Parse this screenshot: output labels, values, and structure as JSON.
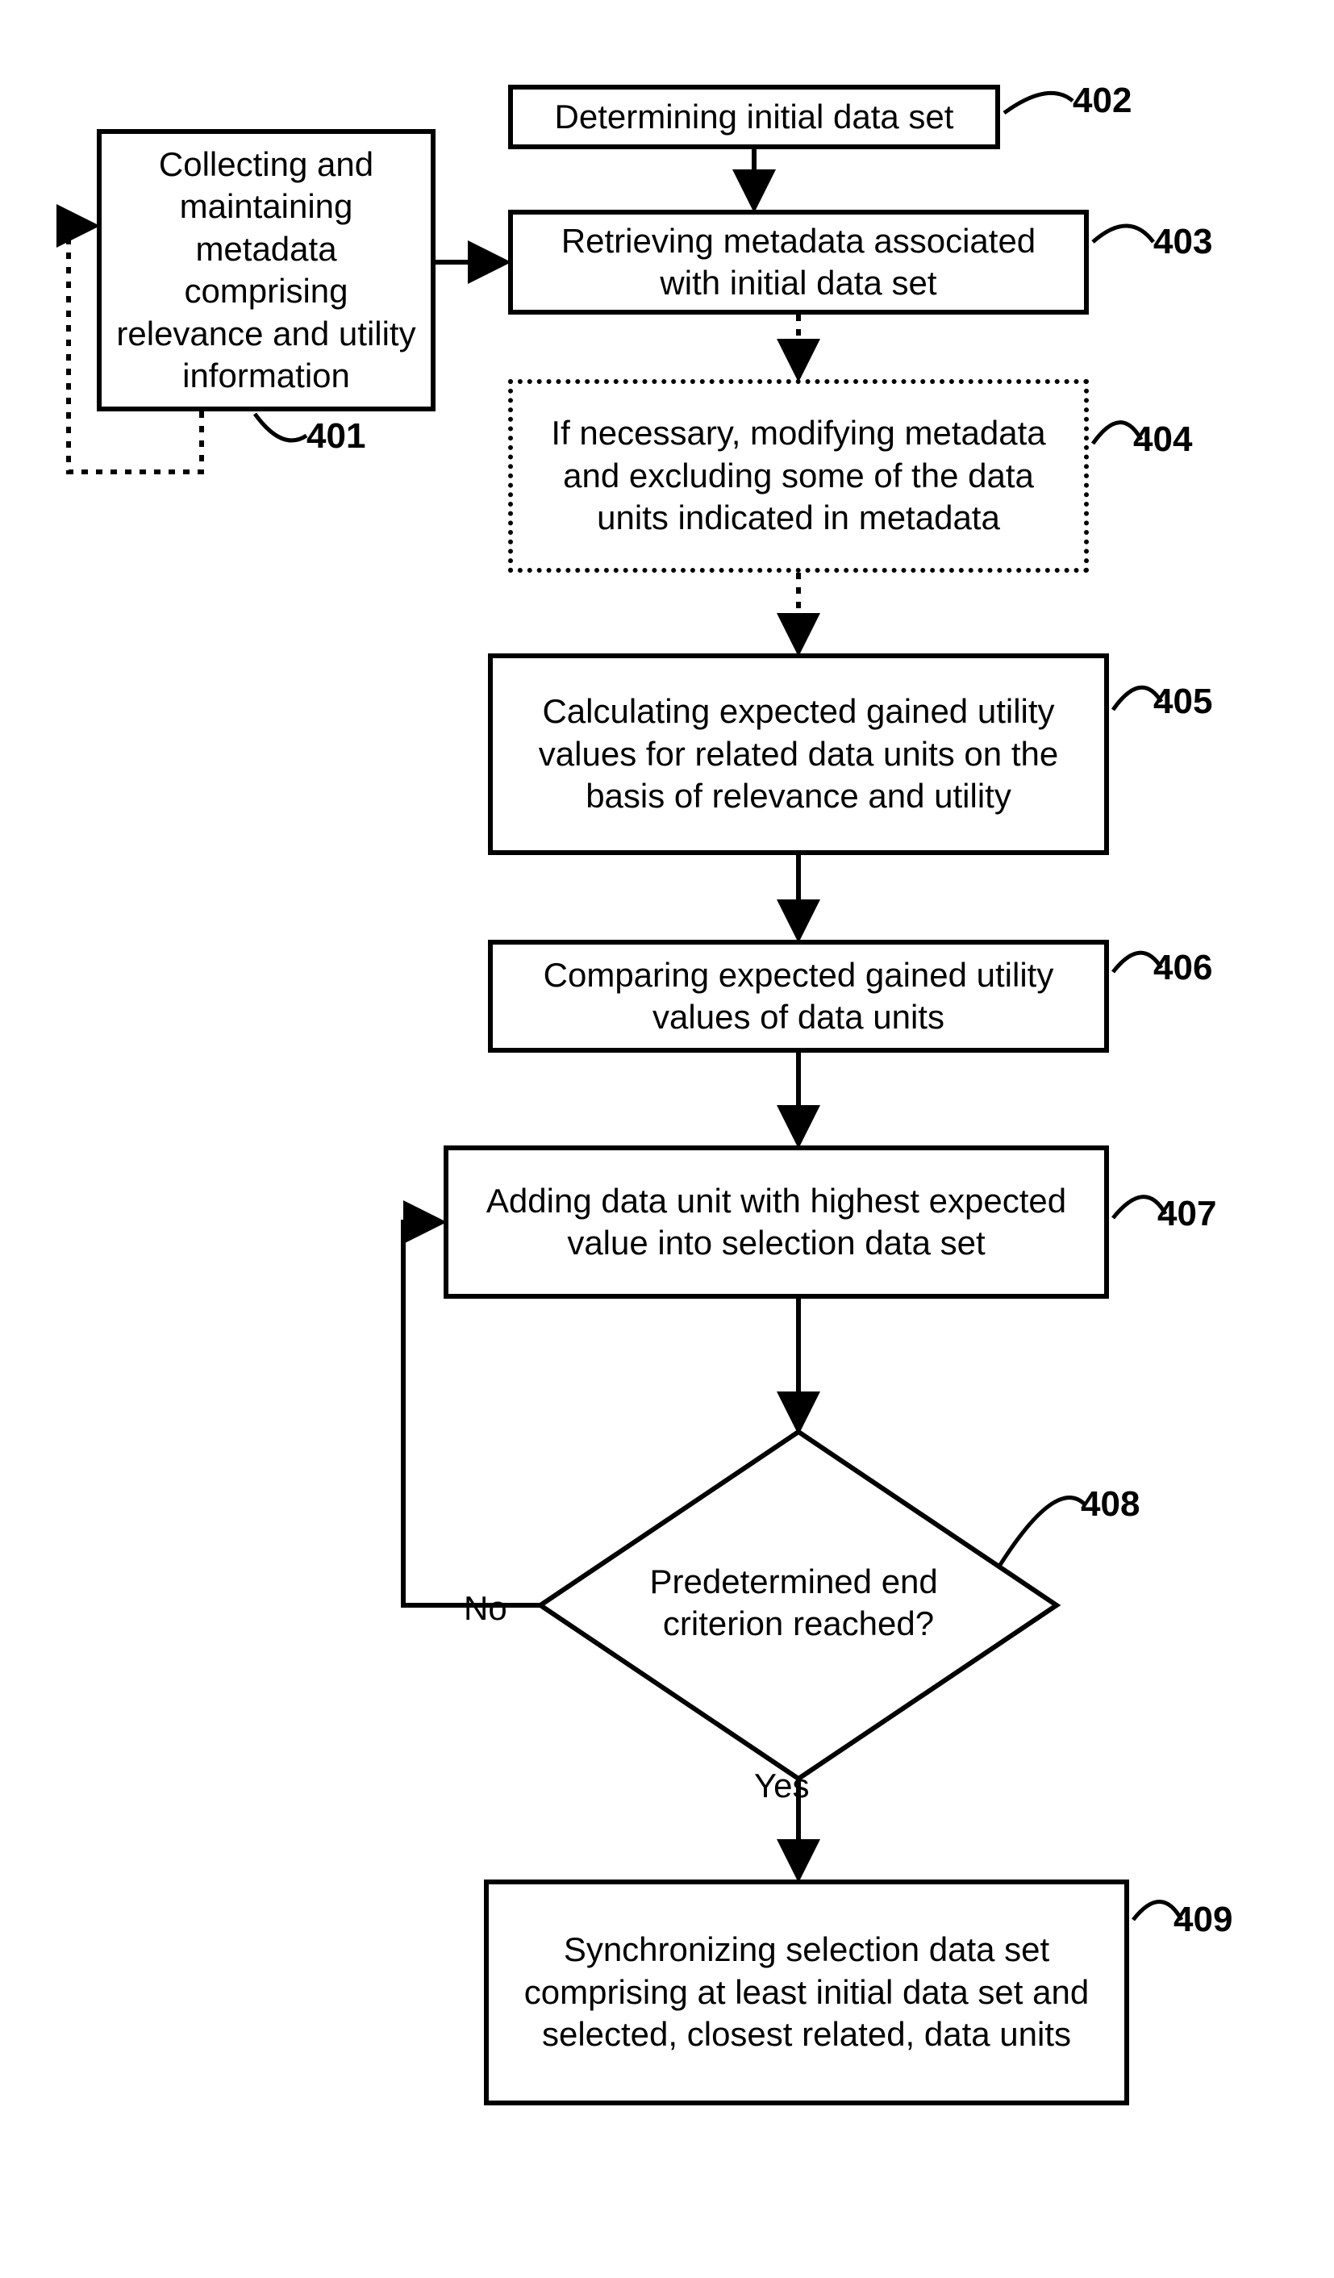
{
  "chart_data": {
    "type": "flowchart",
    "nodes": [
      {
        "id": "401",
        "text": "Collecting and maintaining metadata comprising relevance and utility information",
        "ref": "401",
        "style": "solid"
      },
      {
        "id": "402",
        "text": "Determining initial data set",
        "ref": "402",
        "style": "solid"
      },
      {
        "id": "403",
        "text": "Retrieving metadata associated with initial data set",
        "ref": "403",
        "style": "solid"
      },
      {
        "id": "404",
        "text": "If necessary, modifying metadata and excluding some of the data units indicated in metadata",
        "ref": "404",
        "style": "dotted"
      },
      {
        "id": "405",
        "text": "Calculating expected gained utility values for related data units on the basis of relevance and utility",
        "ref": "405",
        "style": "solid"
      },
      {
        "id": "406",
        "text": "Comparing expected gained utility values of data units",
        "ref": "406",
        "style": "solid"
      },
      {
        "id": "407",
        "text": "Adding data unit with highest expected value into selection data set",
        "ref": "407",
        "style": "solid"
      },
      {
        "id": "408",
        "text": "Predetermined end criterion reached?",
        "ref": "408",
        "style": "diamond"
      },
      {
        "id": "409",
        "text": "Synchronizing selection data set comprising at least initial data set and selected, closest related, data units",
        "ref": "409",
        "style": "solid"
      }
    ],
    "edges": [
      {
        "from": "401",
        "to": "403",
        "style": "solid"
      },
      {
        "from": "402",
        "to": "403",
        "style": "solid"
      },
      {
        "from": "403",
        "to": "404",
        "style": "dotted"
      },
      {
        "from": "404",
        "to": "405",
        "style": "dotted"
      },
      {
        "from": "405",
        "to": "406",
        "style": "solid"
      },
      {
        "from": "406",
        "to": "407",
        "style": "solid"
      },
      {
        "from": "407",
        "to": "408",
        "style": "solid"
      },
      {
        "from": "408",
        "to": "409",
        "label": "Yes",
        "style": "solid"
      },
      {
        "from": "408",
        "to": "407",
        "label": "No",
        "style": "solid"
      },
      {
        "from": "401",
        "to": "401",
        "style": "dotted",
        "note": "self-loop via dotted path"
      }
    ]
  },
  "nodes": {
    "n401": {
      "text": "Collecting and maintaining metadata comprising relevance and utility information",
      "ref": "401"
    },
    "n402": {
      "text": "Determining initial data set",
      "ref": "402"
    },
    "n403": {
      "text": "Retrieving metadata associated with initial data set",
      "ref": "403"
    },
    "n404": {
      "text": "If necessary, modifying metadata and excluding some of the data units indicated in metadata",
      "ref": "404"
    },
    "n405": {
      "text": "Calculating expected gained utility values for related data units on the basis of relevance and utility",
      "ref": "405"
    },
    "n406": {
      "text": "Comparing expected gained utility values of data units",
      "ref": "406"
    },
    "n407": {
      "text": "Adding data unit with highest expected value into selection data set",
      "ref": "407"
    },
    "n408": {
      "text": "Predetermined end criterion reached?",
      "ref": "408"
    },
    "n409": {
      "text": "Synchronizing selection data set comprising at least initial data set and selected, closest related, data units",
      "ref": "409"
    }
  },
  "labels": {
    "no": "No",
    "yes": "Yes"
  }
}
